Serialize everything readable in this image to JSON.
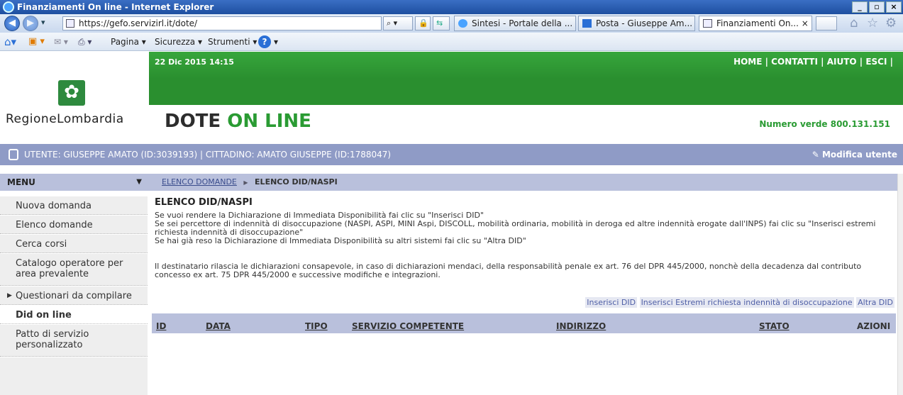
{
  "browser": {
    "window_title": "Finanziamenti On line - Internet Explorer",
    "url": "https://gefo.servizirl.it/dote/",
    "tabs": [
      {
        "label": "Sintesi - Portale della ..."
      },
      {
        "label": "Posta - Giuseppe Am..."
      },
      {
        "label": "Finanziamenti On... ×"
      }
    ],
    "command_bar": {
      "pagina": "Pagina ▾",
      "sicurezza": "Sicurezza ▾",
      "strumenti": "Strumenti ▾"
    }
  },
  "header": {
    "date": "22 Dic 2015 14:15",
    "links": "HOME | CONTATTI | AIUTO | ESCI |",
    "logo_text": "RegioneLombardia",
    "title_part1": "DOTE",
    "title_part2": "ON LINE",
    "numero_verde": "Numero verde 800.131.151",
    "brand_green": "#2a9b33"
  },
  "userbar": {
    "text": "UTENTE: GIUSEPPE AMATO (ID:3039193)  |  CITTADINO: AMATO GIUSEPPE (ID:1788047)",
    "modify": "Modifica utente"
  },
  "menu": {
    "title": "MENU",
    "items": [
      {
        "label": "Nuova domanda"
      },
      {
        "label": "Elenco domande"
      },
      {
        "label": "Cerca corsi"
      },
      {
        "label": "Catalogo operatore per area prevalente"
      },
      {
        "label": "Questionari da compilare"
      },
      {
        "label": "Did on line"
      },
      {
        "label": "Patto di servizio personalizzato"
      }
    ]
  },
  "breadcrumb": {
    "link": "ELENCO DOMANDE",
    "separator": "▶",
    "current": "ELENCO DID/NASPI"
  },
  "main": {
    "title": "ELENCO DID/NASPI",
    "line1": "Se vuoi rendere la Dichiarazione di Immediata Disponibilità fai clic su \"Inserisci DID\"",
    "line2": "Se sei percettore di indennità di disoccupazione (NASPI, ASPI, MINI Aspi, DISCOLL, mobilità ordinaria, mobilità in deroga ed altre indennità erogate dall'INPS) fai clic su \"Inserisci estremi richiesta indennità di disoccupazione\"",
    "line3": "Se hai già reso la Dichiarazione di Immediata Disponibilità su altri sistemi fai clic su \"Altra DID\"",
    "notice": "Il destinatario rilascia le dichiarazioni consapevole, in caso di dichiarazioni mendaci, della responsabilità penale ex art. 76 del DPR 445/2000, nonchè della decadenza dal contributo concesso ex art. 75 DPR 445/2000 e successive modifiche e integrazioni.",
    "actions": {
      "inserisci_did": "Inserisci DID",
      "inserisci_estremi": "Inserisci Estremi richiesta indennità di disoccupazione",
      "altra_did": "Altra DID"
    },
    "table_headers": [
      "ID",
      "DATA",
      "TIPO",
      "SERVIZIO COMPETENTE",
      "INDIRIZZO",
      "STATO",
      "AZIONI"
    ]
  }
}
